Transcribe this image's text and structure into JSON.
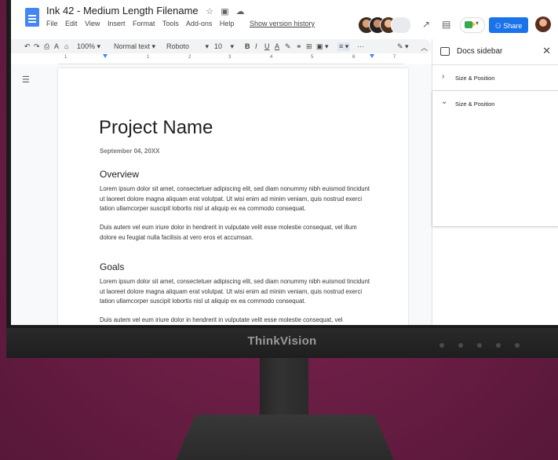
{
  "monitor": {
    "brand": "ThinkVision"
  },
  "docs": {
    "title": "Ink 42 - Medium Length Filename",
    "menu": [
      "File",
      "Edit",
      "View",
      "Insert",
      "Format",
      "Tools",
      "Add-ons",
      "Help"
    ],
    "version_history": "Show version history",
    "share_label": "Share",
    "toolbar": {
      "zoom": "100%",
      "style": "Normal text",
      "font": "Roboto",
      "size": "10",
      "more": "···"
    },
    "ruler_numbers": [
      "1",
      "1",
      "2",
      "3",
      "4",
      "5",
      "6",
      "7"
    ]
  },
  "document": {
    "title": "Project Name",
    "date": "September 04, 20XX",
    "sections": [
      {
        "heading": "Overview",
        "paragraphs": [
          "Lorem ipsum dolor sit amet, consectetuer adipiscing elit, sed diam nonummy nibh euismod tincidunt ut laoreet dolore magna aliquam erat volutpat. Ut wisi enim ad minim veniam, quis nostrud exerci tation ullamcorper suscipit lobortis nisl ut aliquip ex ea commodo consequat.",
          "Duis autem vel eum iriure dolor in hendrerit in vulputate velit esse molestie consequat, vel illum dolore eu feugiat nulla facilisis at vero eros et accumsan."
        ]
      },
      {
        "heading": "Goals",
        "paragraphs": [
          "Lorem ipsum dolor sit amet, consectetuer adipiscing elit, sed diam nonummy nibh euismod tincidunt ut laoreet dolore magna aliquam erat volutpat. Ut wisi enim ad minim veniam, quis nostrud exerci tation ullamcorper suscipit lobortis nisl ut aliquip ex ea commodo consequat.",
          "Duis autem vel eum iriure dolor in hendrerit in vulputate velit esse molestie consequat, vel"
        ]
      }
    ]
  },
  "sidebar": {
    "title": "Docs sidebar",
    "items": [
      {
        "label": "Size & Position",
        "expanded": false
      },
      {
        "label": "Size & Position",
        "expanded": true
      }
    ]
  },
  "colors": {
    "accent": "#1a73e8",
    "background": "#6e1f47"
  }
}
